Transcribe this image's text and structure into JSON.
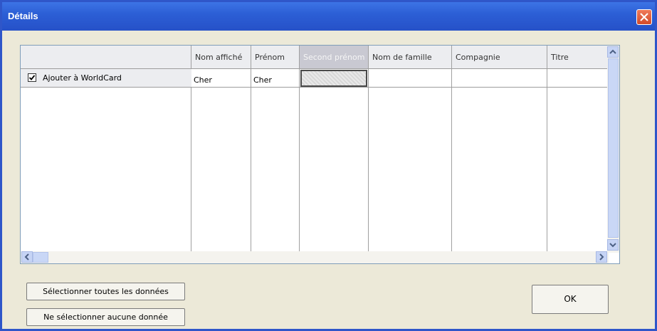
{
  "window": {
    "title": "Détails"
  },
  "grid": {
    "row_header_label": "Ajouter à WorldCard",
    "row_checked": true,
    "columns": [
      "Nom affiché",
      "Prénom",
      "Second prénom",
      "Nom de famille",
      "Compagnie",
      "Titre"
    ],
    "row_values": [
      "Cher",
      "Cher",
      "",
      "",
      "",
      ""
    ]
  },
  "buttons": {
    "select_all": "Sélectionner toutes les données",
    "select_none": "Ne sélectionner aucune donnée",
    "ok": "OK"
  }
}
